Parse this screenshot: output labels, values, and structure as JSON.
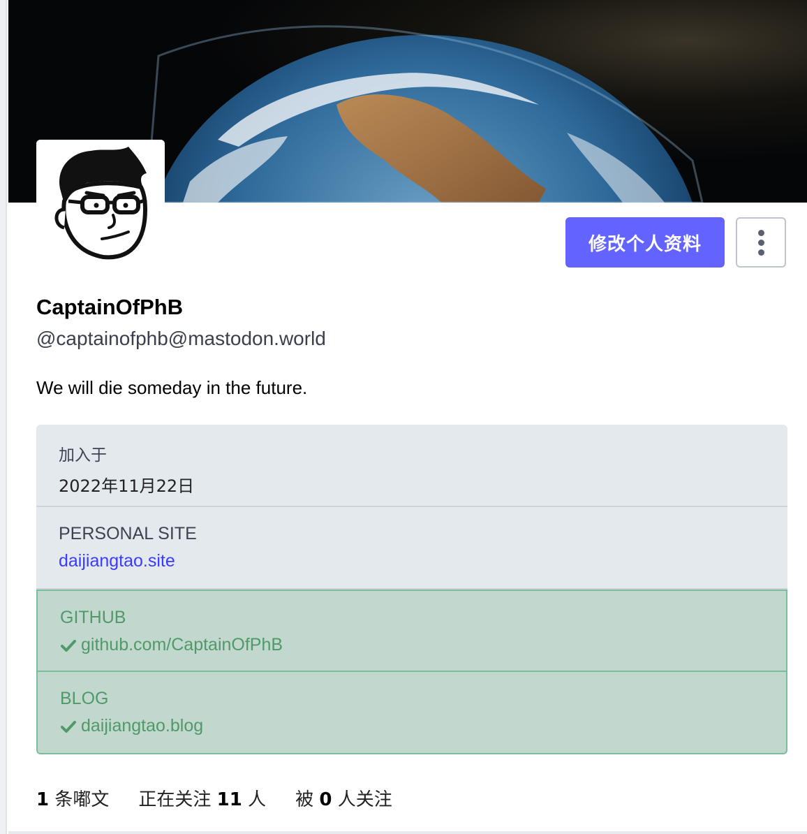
{
  "profile": {
    "display_name": "CaptainOfPhB",
    "handle": "@captainofphb@mastodon.world",
    "bio": "We will die someday in the future."
  },
  "actions": {
    "edit_profile_label": "修改个人资料",
    "more_icon": "vertical-ellipsis-icon"
  },
  "fields": {
    "joined": {
      "label": "加入于",
      "value": "2022年11月22日"
    },
    "personal_site": {
      "label": "PERSONAL SITE",
      "value": "daijiangtao.site"
    },
    "github": {
      "label": "GITHUB",
      "value": "github.com/CaptainOfPhB",
      "verified": true
    },
    "blog": {
      "label": "BLOG",
      "value": "daijiangtao.blog",
      "verified": true
    }
  },
  "stats": {
    "posts_count": "1",
    "posts_label": "条嘟文",
    "following_prefix": "正在关注",
    "following_count": "11",
    "following_suffix": "人",
    "followers_prefix": "被",
    "followers_count": "0",
    "followers_suffix": "人关注"
  },
  "colors": {
    "accent": "#6364ff",
    "verified_green": "#4f9a68",
    "link": "#3b3bff"
  }
}
